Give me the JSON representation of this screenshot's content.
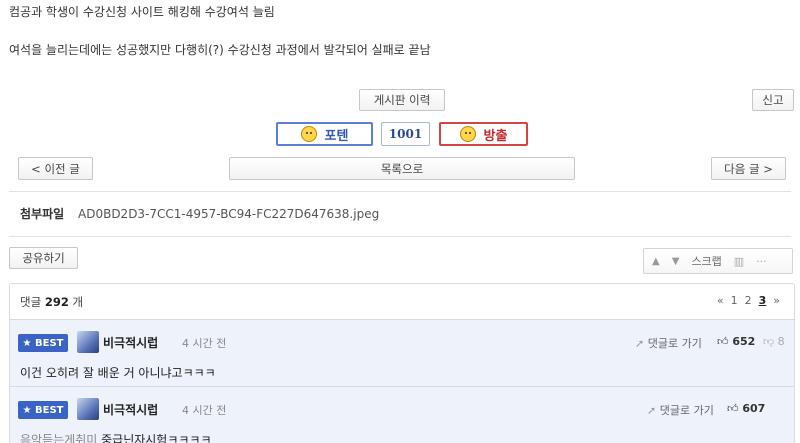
{
  "post": {
    "line1": "컴공과 학생이 수강신청 사이트 해킹해 수강여석 늘림",
    "line2": "여석을 늘리는데에는 성공했지만 다행히(?) 수강신청 과정에서 발각되어 실패로 끝남"
  },
  "actions": {
    "history_label": "게시판 이력",
    "report_label": "신고",
    "upvote_label": "포텐",
    "vote_count": "1001",
    "downvote_label": "방출",
    "prev_label": "< 이전 글",
    "list_label": "목록으로",
    "next_label": "다음 글 >"
  },
  "attachment": {
    "label": "첨부파일",
    "filename": "AD0BD2D3-7CC1-4957-BC94-FC227D647638.jpeg"
  },
  "share_label": "공유하기",
  "toolbar": {
    "scrap_label": "스크랩"
  },
  "comments": {
    "count_prefix": "댓글",
    "count": "292",
    "count_suffix": "개",
    "pages": [
      "«",
      "1",
      "2",
      "3",
      "»"
    ],
    "current_page": "3",
    "items": [
      {
        "badge": "BEST",
        "nick": "비극적시럽",
        "time": "4 시간 전",
        "reply_label": "댓글로 가기",
        "likes": "652",
        "dislikes": "8",
        "text": "이건 오히려 잘 배운 거 아니냐고ㅋㅋㅋ"
      },
      {
        "badge": "BEST",
        "nick": "비극적시럽",
        "time": "4 시간 전",
        "reply_label": "댓글로 가기",
        "likes": "607",
        "dislikes": "",
        "quote": "음악듣는게취미",
        "text": "중급닌자시험ㅋㅋㅋㅋ"
      }
    ]
  },
  "colors": {
    "best_badge": "#3a63c6",
    "upvote_border": "#5b7fd6",
    "downvote_border": "#d64545",
    "comment_bg": "#eef2fb"
  }
}
